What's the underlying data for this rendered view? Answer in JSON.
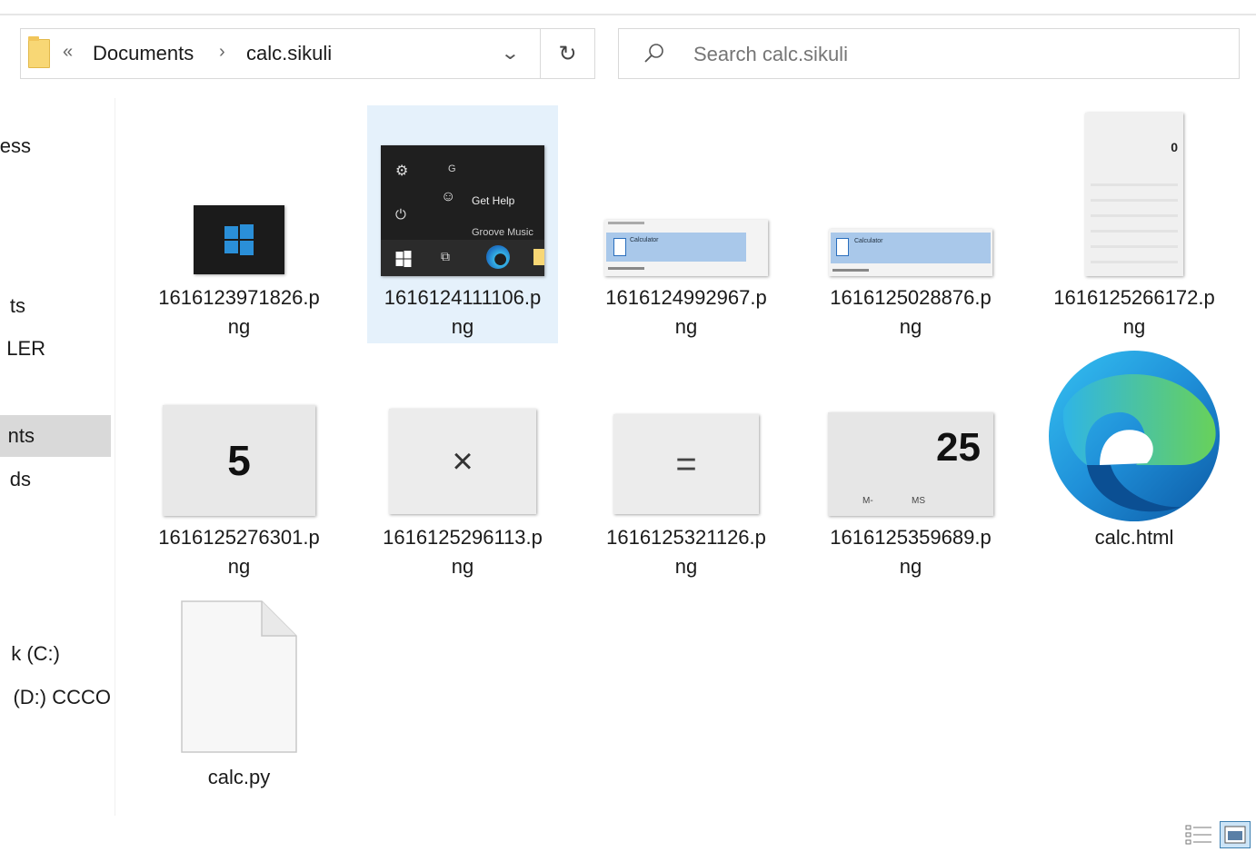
{
  "address": {
    "overflow_glyph": "«",
    "separator_glyph": "›",
    "crumbs": [
      "Documents",
      "calc.sikuli"
    ],
    "dropdown_glyph": "⌄",
    "refresh_glyph": "↻"
  },
  "search": {
    "placeholder": "Search calc.sikuli"
  },
  "nav": {
    "items": [
      {
        "label": "ess"
      },
      {
        "label": "ts"
      },
      {
        "label": "LER"
      },
      {
        "label": "nts",
        "selected": true
      },
      {
        "label": "ds"
      },
      {
        "label": "k (C:)"
      },
      {
        "label": "(D:) CCCO"
      }
    ]
  },
  "files": [
    {
      "name": "1616123971826.png",
      "line1": "1616123971826.p",
      "line2": "ng"
    },
    {
      "name": "1616124111106.png",
      "line1": "1616124111106.p",
      "line2": "ng",
      "selected": true
    },
    {
      "name": "1616124992967.png",
      "line1": "1616124992967.p",
      "line2": "ng"
    },
    {
      "name": "1616125028876.png",
      "line1": "1616125028876.p",
      "line2": "ng"
    },
    {
      "name": "1616125266172.png",
      "line1": "1616125266172.p",
      "line2": "ng"
    },
    {
      "name": "1616125276301.png",
      "line1": "1616125276301.p",
      "line2": "ng"
    },
    {
      "name": "1616125296113.png",
      "line1": "1616125296113.p",
      "line2": "ng"
    },
    {
      "name": "1616125321126.png",
      "line1": "1616125321126.p",
      "line2": "ng"
    },
    {
      "name": "1616125359689.png",
      "line1": "1616125359689.p",
      "line2": "ng"
    },
    {
      "name": "calc.html",
      "line1": "calc.html",
      "line2": ""
    },
    {
      "name": "calc.py",
      "line1": "calc.py",
      "line2": ""
    }
  ],
  "thumb_text": {
    "get_help": "Get Help",
    "groove": "Groove Music",
    "five": "5",
    "times": "×",
    "equals": "=",
    "twenty_five": "25",
    "m_minus": "M-",
    "ms": "MS",
    "calc_zero": "0",
    "calculator": "Calculator"
  },
  "colors": {
    "selection": "#e5f1fb",
    "nav_selected": "#d9d9d9",
    "windows_blue": "#2a8fd8",
    "folder_yellow": "#f8d775"
  }
}
